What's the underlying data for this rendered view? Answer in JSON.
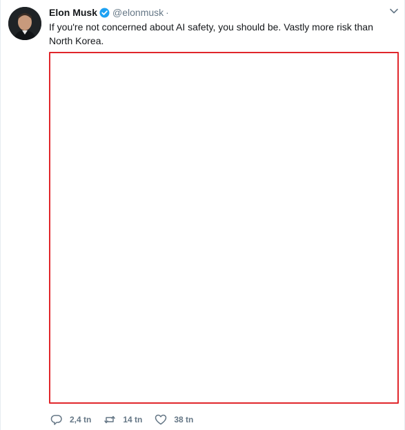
{
  "tweet": {
    "display_name": "Elon Musk",
    "handle": "@elonmusk",
    "separator": "·",
    "verified_icon": "verified-badge-icon",
    "text": "If you're not concerned about AI safety, you should be. Vastly more risk than North Korea.",
    "colors": {
      "text": "#14171a",
      "muted": "#657786",
      "verified": "#1da1f2",
      "media_border": "#e0262b"
    }
  },
  "actions": {
    "reply": {
      "icon": "reply-icon",
      "count": "2,4 tn"
    },
    "retweet": {
      "icon": "retweet-icon",
      "count": "14 tn"
    },
    "like": {
      "icon": "heart-icon",
      "count": "38 tn"
    }
  },
  "menu": {
    "icon": "chevron-down-icon"
  }
}
